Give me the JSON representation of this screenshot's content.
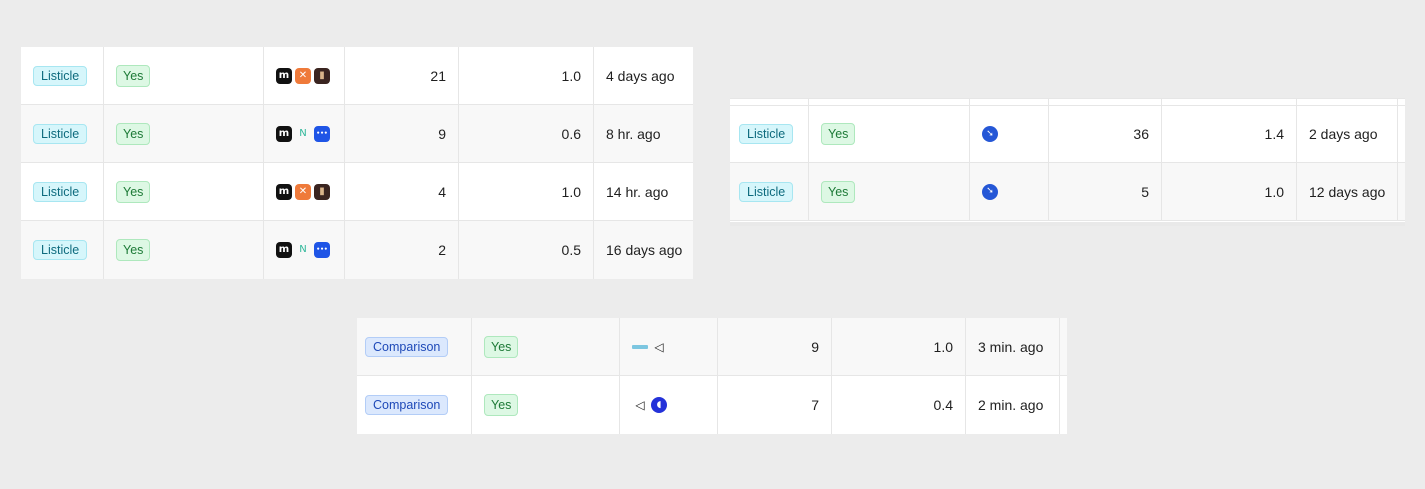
{
  "panels": [
    {
      "rows": [
        {
          "type": "Listicle",
          "status": "Yes",
          "icons": [
            "m-logo-icon",
            "x-logo-icon",
            "dark-app-icon"
          ],
          "count": "21",
          "score": "1.0",
          "updated": "4 days ago"
        },
        {
          "type": "Listicle",
          "status": "Yes",
          "icons": [
            "m-logo-icon",
            "n-logo-icon",
            "blue-app-icon"
          ],
          "count": "9",
          "score": "0.6",
          "updated": "8 hr. ago"
        },
        {
          "type": "Listicle",
          "status": "Yes",
          "icons": [
            "m-logo-icon",
            "x-logo-icon",
            "dark-app-icon"
          ],
          "count": "4",
          "score": "1.0",
          "updated": "14 hr. ago"
        },
        {
          "type": "Listicle",
          "status": "Yes",
          "icons": [
            "m-logo-icon",
            "n-logo-icon",
            "blue-app-icon"
          ],
          "count": "2",
          "score": "0.5",
          "updated": "16 days ago"
        }
      ]
    },
    {
      "rows": [
        {
          "type": "Listicle",
          "status": "Yes",
          "icons": [
            "bird-logo-icon"
          ],
          "count": "36",
          "score": "1.4",
          "updated": "2 days ago"
        },
        {
          "type": "Listicle",
          "status": "Yes",
          "icons": [
            "bird-logo-icon"
          ],
          "count": "5",
          "score": "1.0",
          "updated": "12 days ago"
        }
      ]
    },
    {
      "rows": [
        {
          "type": "Comparison",
          "status": "Yes",
          "icons": [
            "line-logo-icon",
            "triangle-logo-icon"
          ],
          "count": "9",
          "score": "1.0",
          "updated": "3 min. ago"
        },
        {
          "type": "Comparison",
          "status": "Yes",
          "icons": [
            "triangle-logo-icon",
            "pacman-logo-icon"
          ],
          "count": "7",
          "score": "0.4",
          "updated": "2 min. ago"
        }
      ]
    }
  ]
}
